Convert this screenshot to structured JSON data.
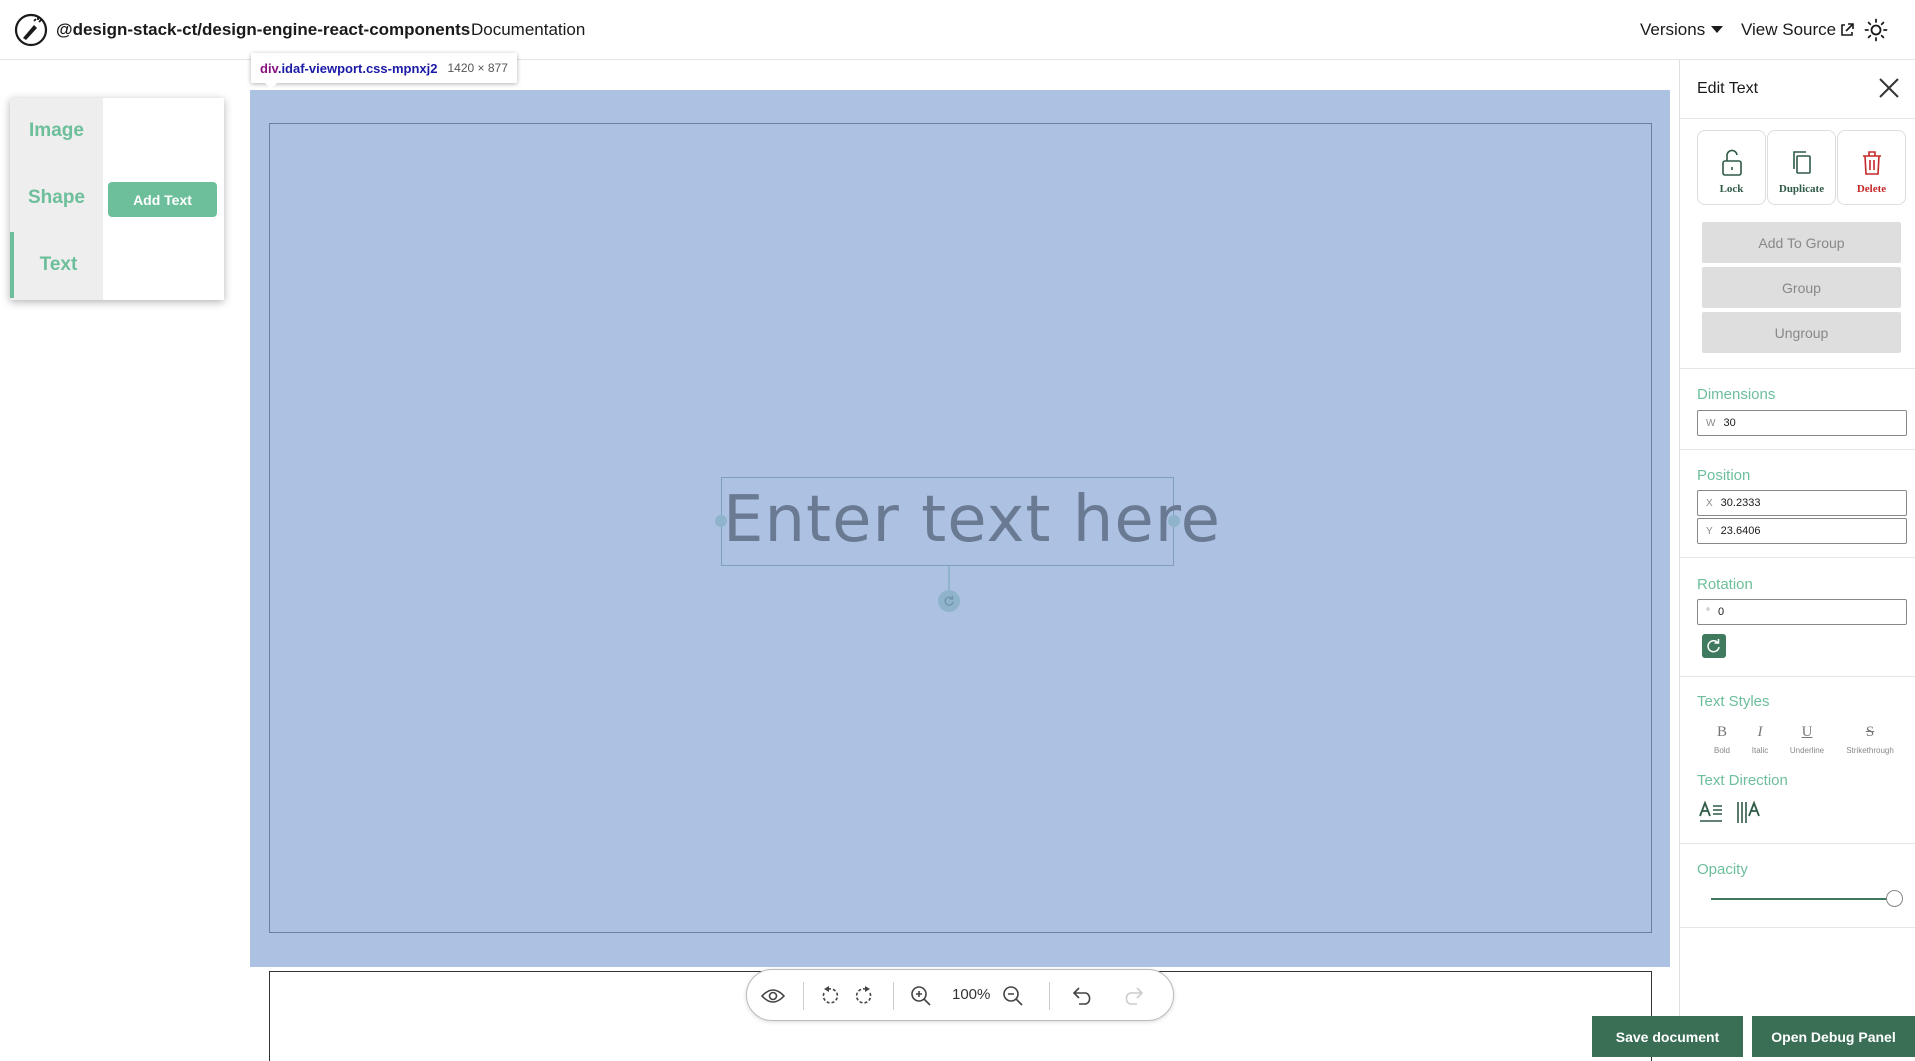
{
  "header": {
    "package_title": "@design-stack-ct/design-engine-react-components",
    "documentation_link": "Documentation",
    "versions_label": "Versions",
    "view_source_label": "View Source"
  },
  "tool_popup": {
    "tabs": [
      {
        "label": "Image",
        "active": false
      },
      {
        "label": "Shape",
        "active": false
      },
      {
        "label": "Text",
        "active": true
      }
    ],
    "add_text_label": "Add Text"
  },
  "devtools_tooltip": {
    "tag": "div",
    "selector": ".idaf-viewport.css-mpnxj2",
    "dimensions": "1420 × 877"
  },
  "canvas": {
    "text_content": "Enter text here",
    "zoom_label": "100%"
  },
  "side_panel": {
    "title": "Edit Text",
    "actions": [
      {
        "label": "Lock",
        "color": "#2f5a46"
      },
      {
        "label": "Duplicate",
        "color": "#2f5a46"
      },
      {
        "label": "Delete",
        "color": "#c62828"
      }
    ],
    "group_buttons": [
      "Add To Group",
      "Group",
      "Ungroup"
    ],
    "dimensions": {
      "label": "Dimensions",
      "width_prefix": "W",
      "width_value": "30"
    },
    "position": {
      "label": "Position",
      "x_prefix": "X",
      "x_value": "30.2333",
      "y_prefix": "Y",
      "y_value": "23.6406"
    },
    "rotation": {
      "label": "Rotation",
      "prefix": "°",
      "value": "0"
    },
    "text_styles": {
      "label": "Text Styles",
      "items": [
        {
          "glyph": "B",
          "label": "Bold"
        },
        {
          "glyph": "I",
          "label": "Italic"
        },
        {
          "glyph": "U",
          "label": "Underline"
        },
        {
          "glyph": "S",
          "label": "Strikethrough"
        }
      ]
    },
    "text_direction": {
      "label": "Text Direction"
    },
    "opacity": {
      "label": "Opacity",
      "value": 1.0
    }
  },
  "footer": {
    "save_label": "Save document",
    "debug_label": "Open Debug Panel"
  },
  "colors": {
    "accent": "#6dbf9b",
    "dark_green": "#3a6f56",
    "viewport_bg": "#adc2e3",
    "delete_red": "#c62828"
  }
}
